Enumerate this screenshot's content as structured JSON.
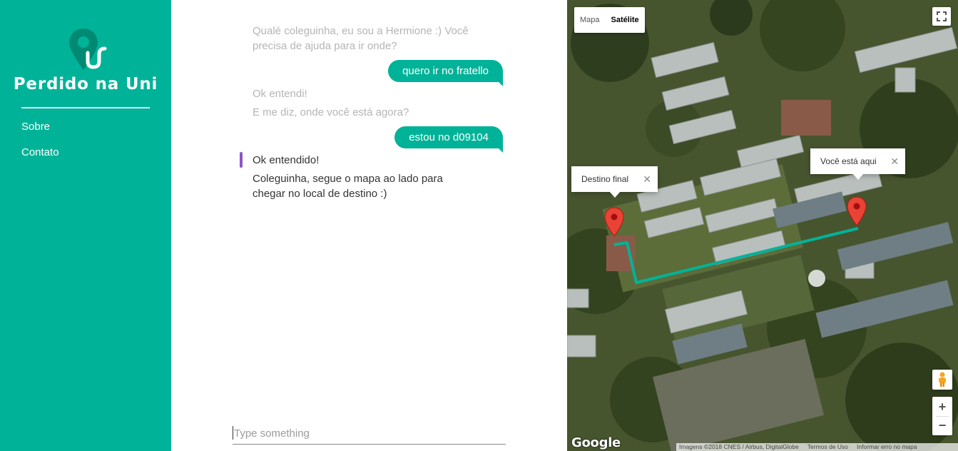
{
  "sidebar": {
    "brand": "Perdido na Uni",
    "nav": [
      {
        "label": "Sobre"
      },
      {
        "label": "Contato"
      }
    ]
  },
  "chat": {
    "bot_intro": "Qualé coleguinha, eu sou a Hermione :) Você precisa de ajuda para ir onde?",
    "user_1": "quero ir no fratello",
    "bot_ack_1": "Ok entendi!",
    "bot_question": "E me diz, onde você está agora?",
    "user_2": "estou no d09104",
    "bot_ack_2": "Ok entendido!",
    "bot_final": "Coleguinha, segue o mapa ao lado para chegar no local de destino :)",
    "input_placeholder": "Type something",
    "input_value": ""
  },
  "map": {
    "type_options": [
      {
        "label": "Mapa",
        "selected": false
      },
      {
        "label": "Satélite",
        "selected": true
      }
    ],
    "markers": [
      {
        "label": "Destino final"
      },
      {
        "label": "Você está aqui"
      }
    ],
    "zoom_in": "+",
    "zoom_out": "−",
    "logo": "Google",
    "footer": {
      "imagery": "Imagens ©2018 CNES / Airbus, DigitalGlobe",
      "terms": "Termos de Uso",
      "report": "Informar erro no mapa"
    },
    "route_color": "#00b398",
    "marker_color": "#ea4335"
  },
  "colors": {
    "brand": "#00b398",
    "accent_marker": "#8e55c9"
  }
}
